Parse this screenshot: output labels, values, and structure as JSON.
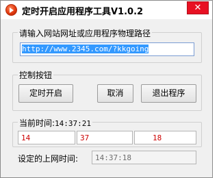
{
  "window": {
    "title": "定时开启应用程序工具V1.0.2",
    "close_label": "✕",
    "icon": "app-play-icon"
  },
  "url_group": {
    "label": "请输入网站网址或应用程序物理路径",
    "url_value": "http://www.2345.com/?kkgoing"
  },
  "controls": {
    "label": "控制按钮",
    "start_button": "定时开启",
    "cancel_button": "取消",
    "exit_button": "退出程序"
  },
  "time": {
    "current_label": "当前时间:",
    "current_value": "14:37:21",
    "hour": "14",
    "minute": "37",
    "second": "18",
    "set_label": "设定的上网时间:",
    "set_value": "14:37:18"
  },
  "colors": {
    "accent": "#e81123",
    "time_text": "#cc0000"
  }
}
